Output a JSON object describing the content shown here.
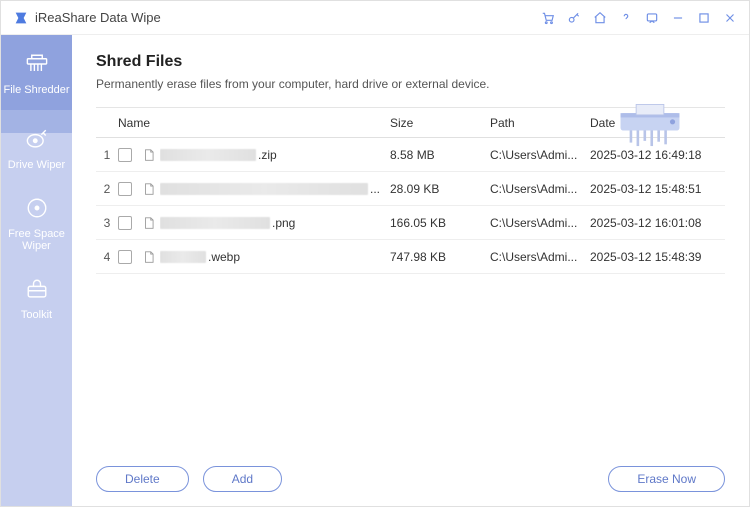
{
  "app_title": "iReaShare Data Wipe",
  "sidebar": {
    "items": [
      {
        "label": "File Shredder"
      },
      {
        "label": "Drive Wiper"
      },
      {
        "label": "Free Space Wiper"
      },
      {
        "label": "Toolkit"
      }
    ]
  },
  "page": {
    "title": "Shred Files",
    "subtitle": "Permanently erase files from your computer, hard drive or external device."
  },
  "table": {
    "headers": {
      "name": "Name",
      "size": "Size",
      "path": "Path",
      "date": "Date"
    },
    "rows": [
      {
        "idx": "1",
        "ext": ".zip",
        "size": "8.58 MB",
        "path": "C:\\Users\\Admi...",
        "date": "2025-03-12 16:49:18",
        "blur_width": 96
      },
      {
        "idx": "2",
        "ext": "...",
        "size": "28.09 KB",
        "path": "C:\\Users\\Admi...",
        "date": "2025-03-12 15:48:51",
        "blur_width": 208
      },
      {
        "idx": "3",
        "ext": ".png",
        "size": "166.05 KB",
        "path": "C:\\Users\\Admi...",
        "date": "2025-03-12 16:01:08",
        "blur_width": 110
      },
      {
        "idx": "4",
        "ext": ".webp",
        "size": "747.98 KB",
        "path": "C:\\Users\\Admi...",
        "date": "2025-03-12 15:48:39",
        "blur_width": 46
      }
    ]
  },
  "buttons": {
    "delete": "Delete",
    "add": "Add",
    "erase_now": "Erase Now"
  }
}
